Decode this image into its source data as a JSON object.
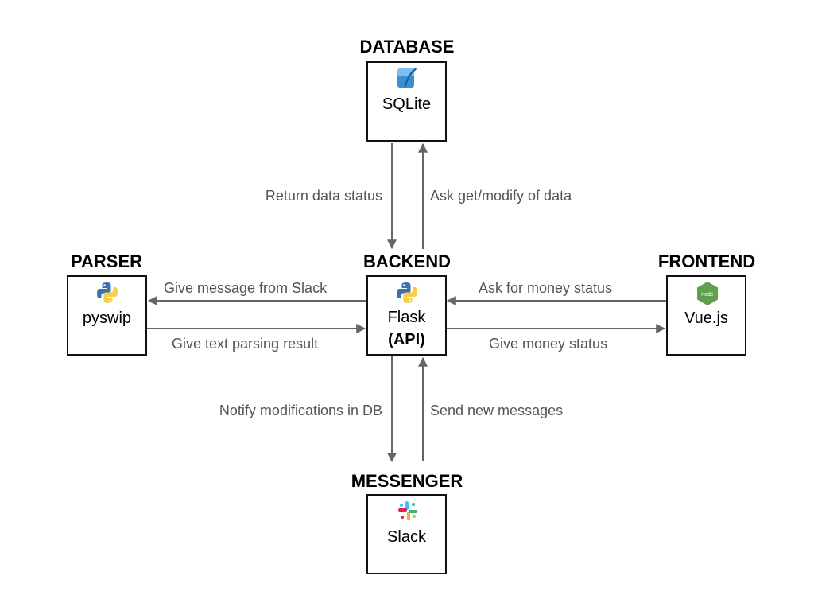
{
  "nodes": {
    "database": {
      "heading": "DATABASE",
      "label": "SQLite",
      "icon": "sqlite-feather-icon"
    },
    "parser": {
      "heading": "PARSER",
      "label": "pyswip",
      "icon": "python-logo-icon"
    },
    "backend": {
      "heading": "BACKEND",
      "label_line1": "Flask",
      "label_line2": "(API)",
      "icon": "python-logo-icon"
    },
    "frontend": {
      "heading": "FRONTEND",
      "label": "Vue.js",
      "icon": "node-hexagon-icon",
      "icon_text": "node"
    },
    "messenger": {
      "heading": "MESSENGER",
      "label": "Slack",
      "icon": "slack-logo-icon"
    }
  },
  "edges": {
    "backend_to_database": "Ask get/modify of data",
    "database_to_backend": "Return data status",
    "backend_to_parser": "Give message from Slack",
    "parser_to_backend": "Give text parsing result",
    "frontend_to_backend": "Ask for money status",
    "backend_to_frontend": "Give money status",
    "backend_to_messenger": "Notify modifications in DB",
    "messenger_to_backend": "Send new messages"
  },
  "colors": {
    "arrow": "#666666",
    "edge_text": "#555555",
    "sqlite_blue": "#3b8ed3",
    "python_blue": "#3b74ad",
    "python_yellow": "#f5cf4a",
    "node_green": "#5fa04e",
    "slack_red": "#e01e5a",
    "slack_green": "#2eb67d",
    "slack_blue": "#36c5f0",
    "slack_yellow": "#ecb22e"
  }
}
